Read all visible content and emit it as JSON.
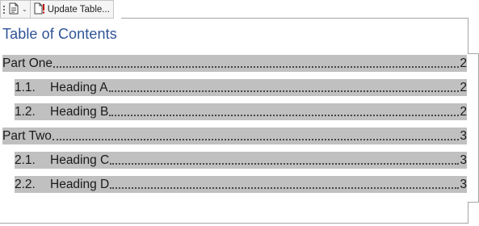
{
  "toolbar": {
    "menu_icon": "document-icon",
    "update_icon": "document-exclamation-icon",
    "update_label": "Update Table..."
  },
  "toc": {
    "title": "Table of Contents",
    "title_color": "#2f5496",
    "highlight_color": "#c0c0c0",
    "entries": [
      {
        "number": "",
        "label": "Part One",
        "page": "2",
        "level": 1
      },
      {
        "number": "1.1.",
        "label": "Heading A",
        "page": "2",
        "level": 2
      },
      {
        "number": "1.2.",
        "label": "Heading B",
        "page": "2",
        "level": 2
      },
      {
        "number": "",
        "label": "Part Two",
        "page": "3",
        "level": 1
      },
      {
        "number": "2.1.",
        "label": "Heading C",
        "page": "3",
        "level": 2
      },
      {
        "number": "2.2.",
        "label": "Heading D",
        "page": "3",
        "level": 2
      }
    ]
  }
}
